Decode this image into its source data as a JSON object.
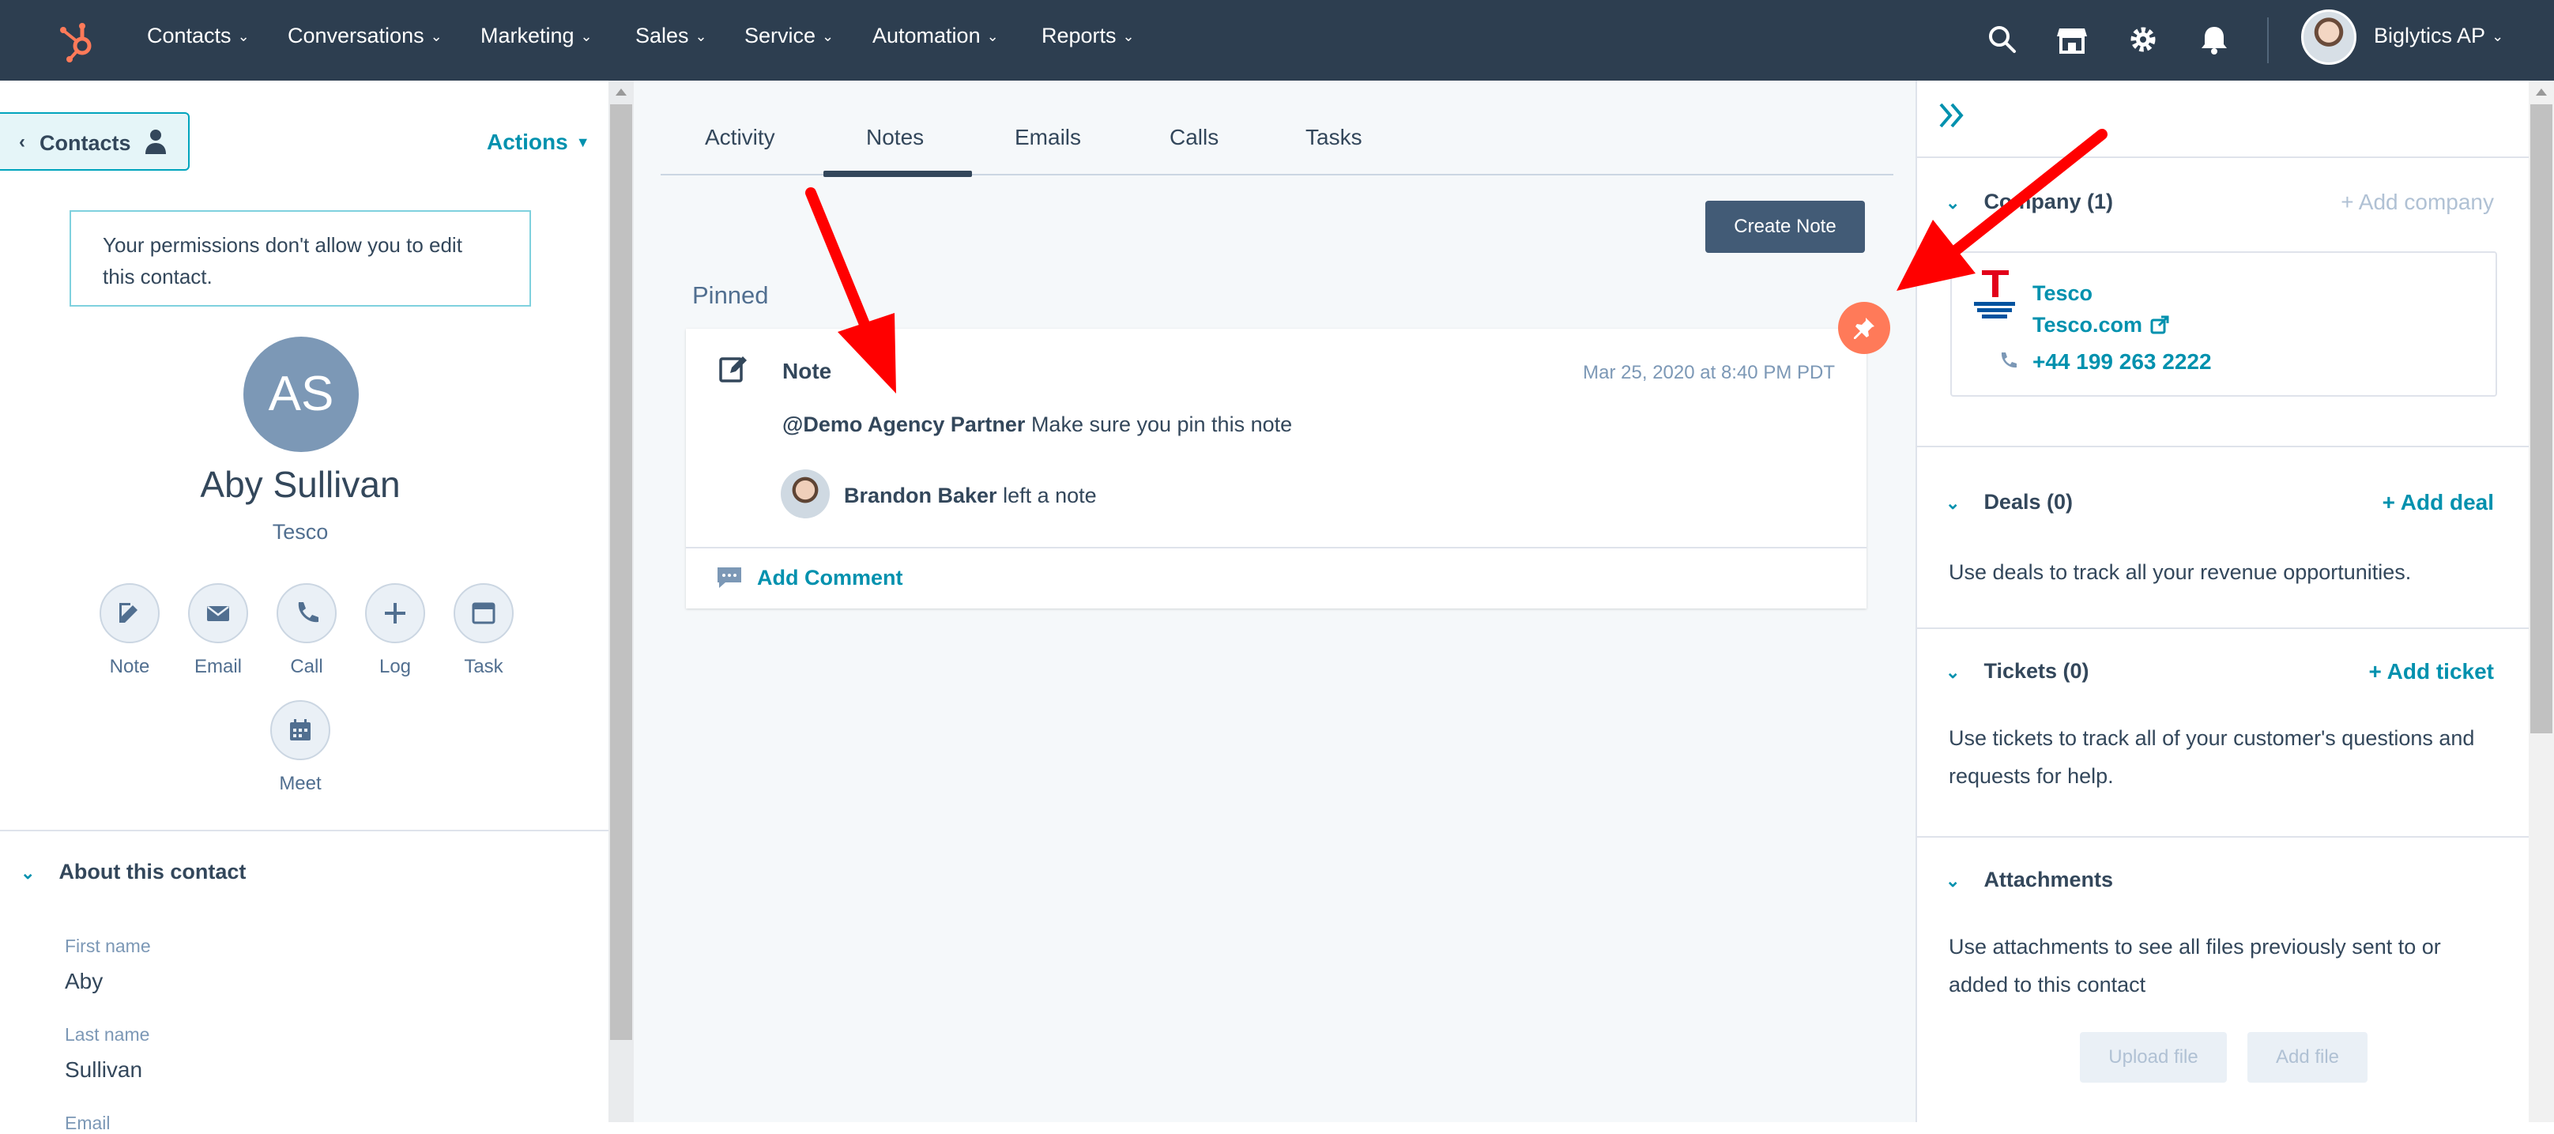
{
  "topnav": {
    "items": [
      "Contacts",
      "Conversations",
      "Marketing",
      "Sales",
      "Service",
      "Automation",
      "Reports"
    ],
    "user_name": "Biglytics AP"
  },
  "left": {
    "back_label": "Contacts",
    "actions_label": "Actions",
    "permission_message": "Your permissions don't allow you to edit this contact.",
    "avatar_initials": "AS",
    "contact_name": "Aby Sullivan",
    "company": "Tesco",
    "activity_buttons": [
      "Note",
      "Email",
      "Call",
      "Log",
      "Task",
      "Meet"
    ],
    "about_heading": "About this contact",
    "fields": [
      {
        "label": "First name",
        "value": "Aby"
      },
      {
        "label": "Last name",
        "value": "Sullivan"
      }
    ],
    "partial_field_label": "Email"
  },
  "middle": {
    "tabs": [
      "Activity",
      "Notes",
      "Emails",
      "Calls",
      "Tasks"
    ],
    "active_tab": "Notes",
    "create_note_label": "Create Note",
    "pinned_label": "Pinned",
    "note": {
      "title": "Note",
      "date": "Mar 25, 2020 at 8:40 PM PDT",
      "mention": "@Demo Agency Partner",
      "body": "Make sure you pin this note",
      "author": "Brandon Baker",
      "author_action": "left a note"
    },
    "add_comment_label": "Add Comment"
  },
  "right": {
    "company_heading": "Company (1)",
    "add_company_label": "+ Add company",
    "company": {
      "name": "Tesco",
      "domain": "Tesco.com",
      "phone": "+44 199 263 2222"
    },
    "deals_heading": "Deals (0)",
    "add_deal_label": "+ Add deal",
    "deals_text": "Use deals to track all your revenue opportunities.",
    "tickets_heading": "Tickets (0)",
    "add_ticket_label": "+ Add ticket",
    "tickets_text": "Use tickets to track all of your customer's questions and requests for help.",
    "attachments_heading": "Attachments",
    "attachments_text": "Use attachments to see all files previously sent to or added to this contact",
    "upload_file_label": "Upload file",
    "add_file_label": "Add file"
  },
  "colors": {
    "nav_bg": "#2d3e50",
    "link": "#0091ae",
    "accent_orange": "#ff7a59",
    "annotation_arrow": "#ff0000"
  },
  "icons": [
    "hubspot-logo-icon",
    "search-icon",
    "marketplace-icon",
    "gear-icon",
    "bell-icon",
    "pin-icon",
    "expand-icon",
    "note-edit-icon",
    "comment-icon",
    "phone-icon",
    "external-link-icon",
    "person-icon"
  ]
}
